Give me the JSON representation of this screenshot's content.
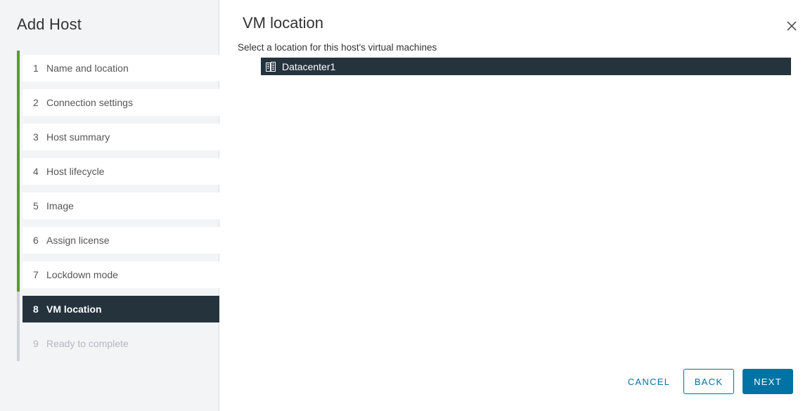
{
  "wizard": {
    "title": "Add Host",
    "steps": [
      {
        "num": "1",
        "label": "Name and location",
        "state": "complete"
      },
      {
        "num": "2",
        "label": "Connection settings",
        "state": "complete"
      },
      {
        "num": "3",
        "label": "Host summary",
        "state": "complete"
      },
      {
        "num": "4",
        "label": "Host lifecycle",
        "state": "complete"
      },
      {
        "num": "5",
        "label": "Image",
        "state": "complete"
      },
      {
        "num": "6",
        "label": "Assign license",
        "state": "complete"
      },
      {
        "num": "7",
        "label": "Lockdown mode",
        "state": "complete"
      },
      {
        "num": "8",
        "label": "VM location",
        "state": "active"
      },
      {
        "num": "9",
        "label": "Ready to complete",
        "state": "disabled"
      }
    ]
  },
  "main": {
    "title": "VM location",
    "subtitle": "Select a location for this host's virtual machines",
    "tree": {
      "items": [
        {
          "label": "Datacenter1",
          "icon": "datacenter-icon",
          "selected": true
        }
      ]
    }
  },
  "footer": {
    "cancel_label": "CANCEL",
    "back_label": "BACK",
    "next_label": "NEXT"
  },
  "icons": {
    "close": "close-icon",
    "datacenter": "datacenter-icon"
  },
  "colors": {
    "accent": "#0072a3",
    "progress": "#5a9a2b",
    "active_step_bg": "#25333d",
    "selected_row_bg": "#25333d"
  }
}
